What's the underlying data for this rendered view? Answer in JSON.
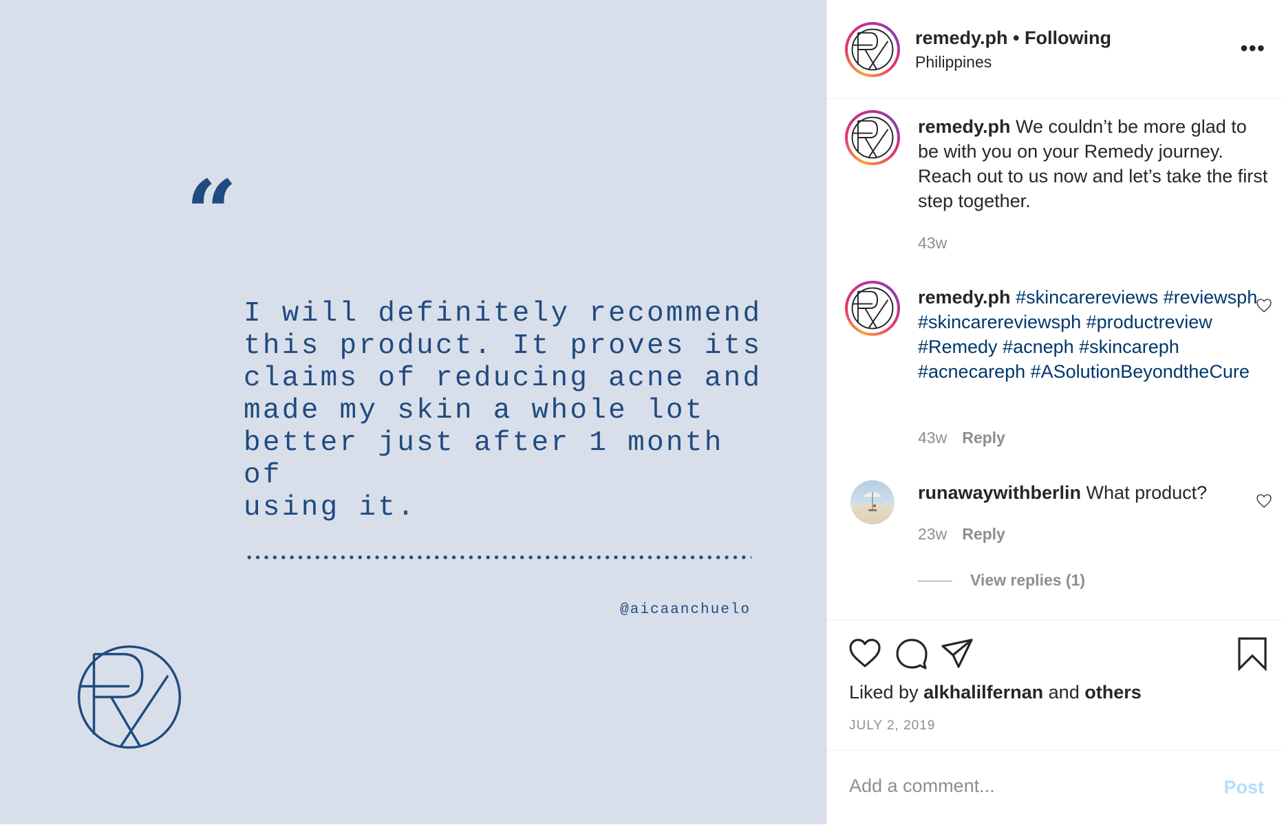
{
  "post_image": {
    "quote_mark": "“",
    "quote": "I will definitely recommend\nthis product. It proves its\nclaims of reducing acne and\nmade my skin a whole lot\nbetter just after 1 month of\nusing it.",
    "author": "@aicaanchuelo",
    "logo": "rx-logo",
    "background_color": "#d9dfea",
    "accent_color": "#1f4b80"
  },
  "header": {
    "username": "remedy.ph",
    "separator": " • ",
    "follow_status": "Following",
    "location": "Philippines",
    "more_label": "•••"
  },
  "comments": [
    {
      "username": "remedy.ph",
      "text": " We couldn’t be more glad to be with you on your Remedy journey. Reach out to us now and let’s take the first step together.",
      "time": "43w"
    },
    {
      "username": "remedy.ph",
      "tags": "#skincarereviews #reviewsph #skincarereviewsph #productreview #Remedy #acneph #skincareph #acnecareph #ASolutionBeyondtheCure",
      "time": "43w",
      "reply_label": "Reply"
    },
    {
      "username": "runawaywithberlin",
      "text": " What product?",
      "time": "23w",
      "reply_label": "Reply",
      "view_replies": "View replies (1)"
    }
  ],
  "actions": {
    "liked_by_prefix": "Liked by ",
    "liked_by_user": "alkhalilfernan",
    "liked_by_middle": " and ",
    "liked_by_others": "others",
    "date": "JULY 2, 2019"
  },
  "add_comment": {
    "placeholder": "Add a comment...",
    "post_label": "Post"
  },
  "colors": {
    "link": "#00376b",
    "muted": "#8e8e8e",
    "post_disabled": "#b2dffc"
  }
}
